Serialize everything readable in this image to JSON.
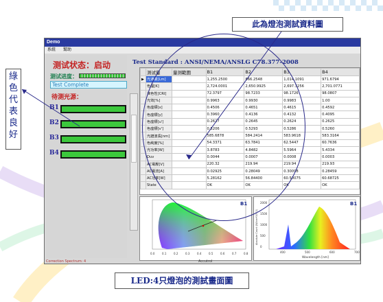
{
  "window": {
    "title": "Demo",
    "menu": [
      "系統",
      "幫助"
    ]
  },
  "left_panel": {
    "status_title": "测试状态：启动",
    "progress_label": "测试进度：",
    "progress_value": 1.0,
    "complete_text": "Test Complete",
    "pending_label": "待测光源：",
    "lamps": [
      "B1",
      "B2",
      "B3",
      "B4"
    ]
  },
  "standard_title": "Test Standard : ANSI/NEMA/ANSLG C78.377-2008",
  "table": {
    "headers": [
      "测试量",
      "量测範圍",
      "B1",
      "B2",
      "B3",
      "B4"
    ],
    "rows": [
      {
        "name": "光通量[Lm]",
        "b1": "1,255.2500",
        "b2": "866.2548",
        "b3": "1,014.1091",
        "b4": "971.6794"
      },
      {
        "name": "色温[K]",
        "b1": "2,724.0001",
        "b2": "2,650.9925",
        "b3": "2,697.3256",
        "b4": "2,701.0771"
      },
      {
        "name": "演色性[CRI]",
        "b1": "72.3797",
        "b2": "98.7233",
        "b3": "98.1726",
        "b4": "98.0807"
      },
      {
        "name": "光效[%]",
        "b1": "0.9963",
        "b2": "0.9930",
        "b3": "0.9983",
        "b4": "1.00"
      },
      {
        "name": "色座標[x]",
        "b1": "0.4506",
        "b2": "0.4651",
        "b3": "0.4615",
        "b4": "0.4592"
      },
      {
        "name": "色座標[y]",
        "b1": "0.3960",
        "b2": "0.4136",
        "b3": "0.4132",
        "b4": "0.4095"
      },
      {
        "name": "色座標[u']",
        "b1": "0.2627",
        "b2": "0.2645",
        "b3": "0.2624",
        "b4": "0.2625"
      },
      {
        "name": "色座標[v']",
        "b1": "0.5206",
        "b2": "0.5293",
        "b3": "0.5286",
        "b4": "0.5260"
      },
      {
        "name": "光譜波長[nm]",
        "b1": "585.6878",
        "b2": "584.2414",
        "b3": "583.9618",
        "b4": "583.3164"
      },
      {
        "name": "色純度[%]",
        "b1": "54.3371",
        "b2": "63.7841",
        "b3": "62.5447",
        "b4": "60.7636"
      },
      {
        "name": "光功率[W]",
        "b1": "3.8783",
        "b2": "4.8482",
        "b3": "5.5964",
        "b4": "5.4334"
      },
      {
        "name": "Duv",
        "b1": "0.0044",
        "b2": "0.0007",
        "b3": "0.0008",
        "b4": "0.0003"
      },
      {
        "name": "AC電壓[V]",
        "b1": "220.32",
        "b2": "219.94",
        "b3": "219.94",
        "b4": "219.93"
      },
      {
        "name": "AC電流[A]",
        "b1": "0.02925",
        "b2": "0.28049",
        "b3": "0.30098",
        "b4": "0.28459"
      },
      {
        "name": "AC功率[W]",
        "b1": "5.28162",
        "b2": "56.84400",
        "b3": "60.50075",
        "b4": "60.68725"
      },
      {
        "name": "State",
        "b1": "OK",
        "b2": "OK",
        "b3": "OK",
        "b4": "OK"
      }
    ]
  },
  "charts": {
    "cie_label": "B1",
    "cie_xticks": [
      "0.0",
      "0.1",
      "0.2",
      "0.3",
      "0.4",
      "0.5",
      "0.6",
      "0.7",
      "0.8"
    ],
    "spectrum_label": "B1",
    "spectrum_xlabel": "Wavelength [nm]",
    "spectrum_ylabel": "Absolute Count (W/nm*10^2)",
    "spectrum_xticks": [
      "400",
      "500",
      "600",
      "700"
    ],
    "spectrum_yticks": [
      "2000",
      "1500",
      "1000",
      "500",
      "0"
    ]
  },
  "bottom_bar": {
    "left": "Correction Spectrum: 4",
    "center": "Accutrol"
  },
  "annotations": {
    "top": "此為燈泡測試資料圖",
    "left": "綠色代表良好",
    "bottom": "LED:4只燈泡的測試畫面圖"
  },
  "colors": {
    "title_blue": "#2a3aa0",
    "status_red": "#c42222",
    "good_green": "#3cc83c",
    "annotation_blue": "#1a2a8a"
  }
}
